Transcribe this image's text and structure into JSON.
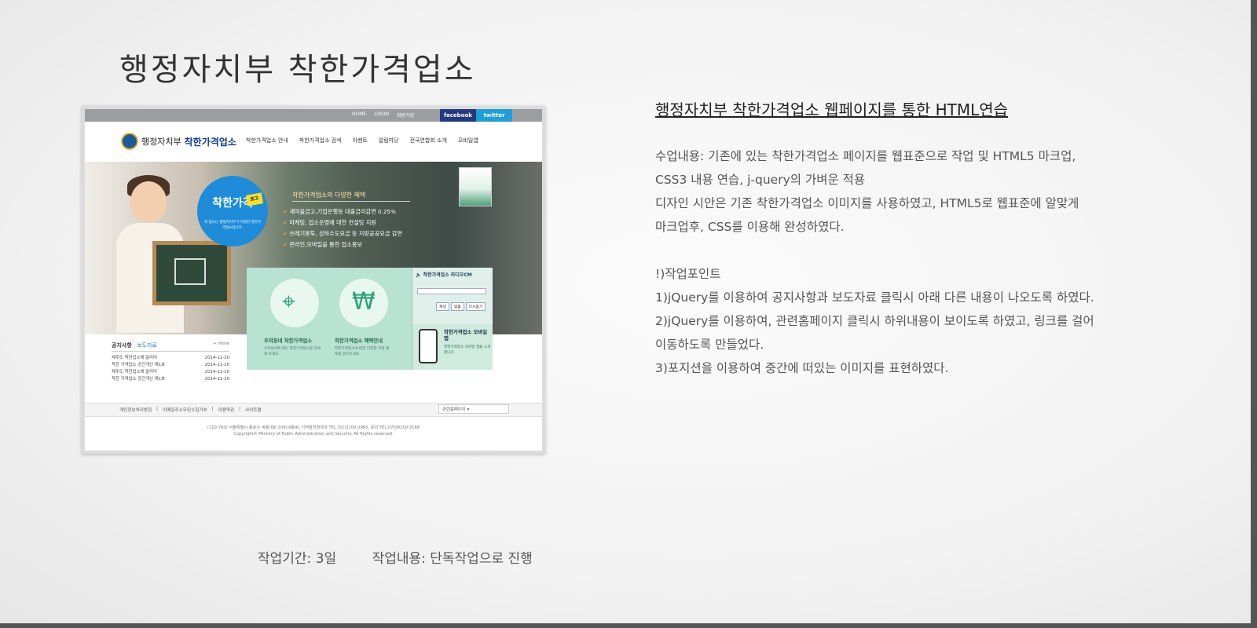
{
  "page_title": "행정자치부 착한가격업소",
  "screenshot": {
    "util_links": [
      "HOME",
      "LOGIN",
      "회원가입"
    ],
    "social": {
      "facebook": "facebook",
      "twitter": "twitter"
    },
    "logo": {
      "ministry": "행정자치부",
      "brand": "착한가격업소"
    },
    "nav": [
      "착한가격업소 안내",
      "착한가격업소 검색",
      "이벤트",
      "알림마당",
      "전국연합회 소개",
      "모바일앱"
    ],
    "badge": {
      "title": "착한가격",
      "tag": "로고",
      "sub": "위 업소는 행정자치부가 지정한 착한가격업소입니다."
    },
    "benefits_title": "착한가격업소의 다양한 혜택",
    "benefits": [
      "새마을금고,기업은행등 대출금리감면 0.25%",
      "마케팅, 업소운영에 대한 컨설팅 지원",
      "쓰레기봉투, 상하수도요금 등 지방공공요금 감면",
      "온라인,모바일을 통한 업소홍보"
    ],
    "tiles": [
      {
        "label": "우리동네 착한가격업소",
        "desc": "우리동네에 있는 착한가격업소를 검색해 보세요."
      },
      {
        "label": "착한가격업소 혜택안내",
        "desc": "착한가격업소에 대한 다양한 지원 혜택을 알아보세요."
      }
    ],
    "radio": {
      "title": "착한가격업소 라디오CM",
      "buttons": [
        "재생",
        "멈춤",
        "다시듣기"
      ]
    },
    "mobile": {
      "title": "착한가격업소 모바일앱",
      "desc": "착한가격업소 모바일 앱을 소개합니다."
    },
    "notice": {
      "tab_active": "공지사항",
      "tab_other": "보도자료",
      "more": "+ more",
      "rows": [
        {
          "title": "제주도 착한업소에 알리미",
          "date": "2014-11-10"
        },
        {
          "title": "착한 가격업소 공간개선 제1호",
          "date": "2014-11-10"
        },
        {
          "title": "제주도 착한업소에 알리미",
          "date": "2014-11-10"
        },
        {
          "title": "착한 가격업소 공간개선 제1호",
          "date": "2014-11-10"
        }
      ]
    },
    "footer_links": [
      "개인정보처리방침",
      "|",
      "이메일주소무단수집거부",
      "|",
      "이용약관",
      "|",
      "사이트맵"
    ],
    "related_sites": "관련홈페이지 ▾",
    "copyright_1": "(110-760) 서울특별시 종로구 세종대로 209(세종로) 지역발전정책과 TEL.(02)2100-2965, 문의 TEL.070)8250-3168",
    "copyright_2": "Copyright© Ministry of Public Administration and Security. All Rights reserved."
  },
  "description": {
    "title": "행정자치부 착한가격업소 웹페이지를 통한 HTML연습",
    "lines": [
      "수업내용: 기존에 있는 착한가격업소 페이지를 웹표준으로 작업 및 HTML5 마크업,",
      " CSS3 내용 연습, j-query의 가벼운 적용",
      "디자인 시안은 기존 착한가격업소 이미지를 사용하였고, HTML5로 웹표준에 알맞게",
      "마크업후, CSS를 이용해 완성하였다.",
      "",
      "!)작업포인트",
      "1)jQuery를 이용하여 공지사항과 보도자료 클릭시 아래 다른 내용이 나오도록 하였다.",
      "2)jQuery를 이용하여, 관련홈페이지 클릭시 하위내용이 보이도록 하였고, 링크를 걸어",
      "이동하도록 만들었다.",
      "3)포지션을 이용하여 중간에 떠있는 이미지를 표현하였다."
    ]
  },
  "footer": {
    "period": "작업기간: 3일",
    "content": "작업내용: 단독작업으로 진행"
  }
}
